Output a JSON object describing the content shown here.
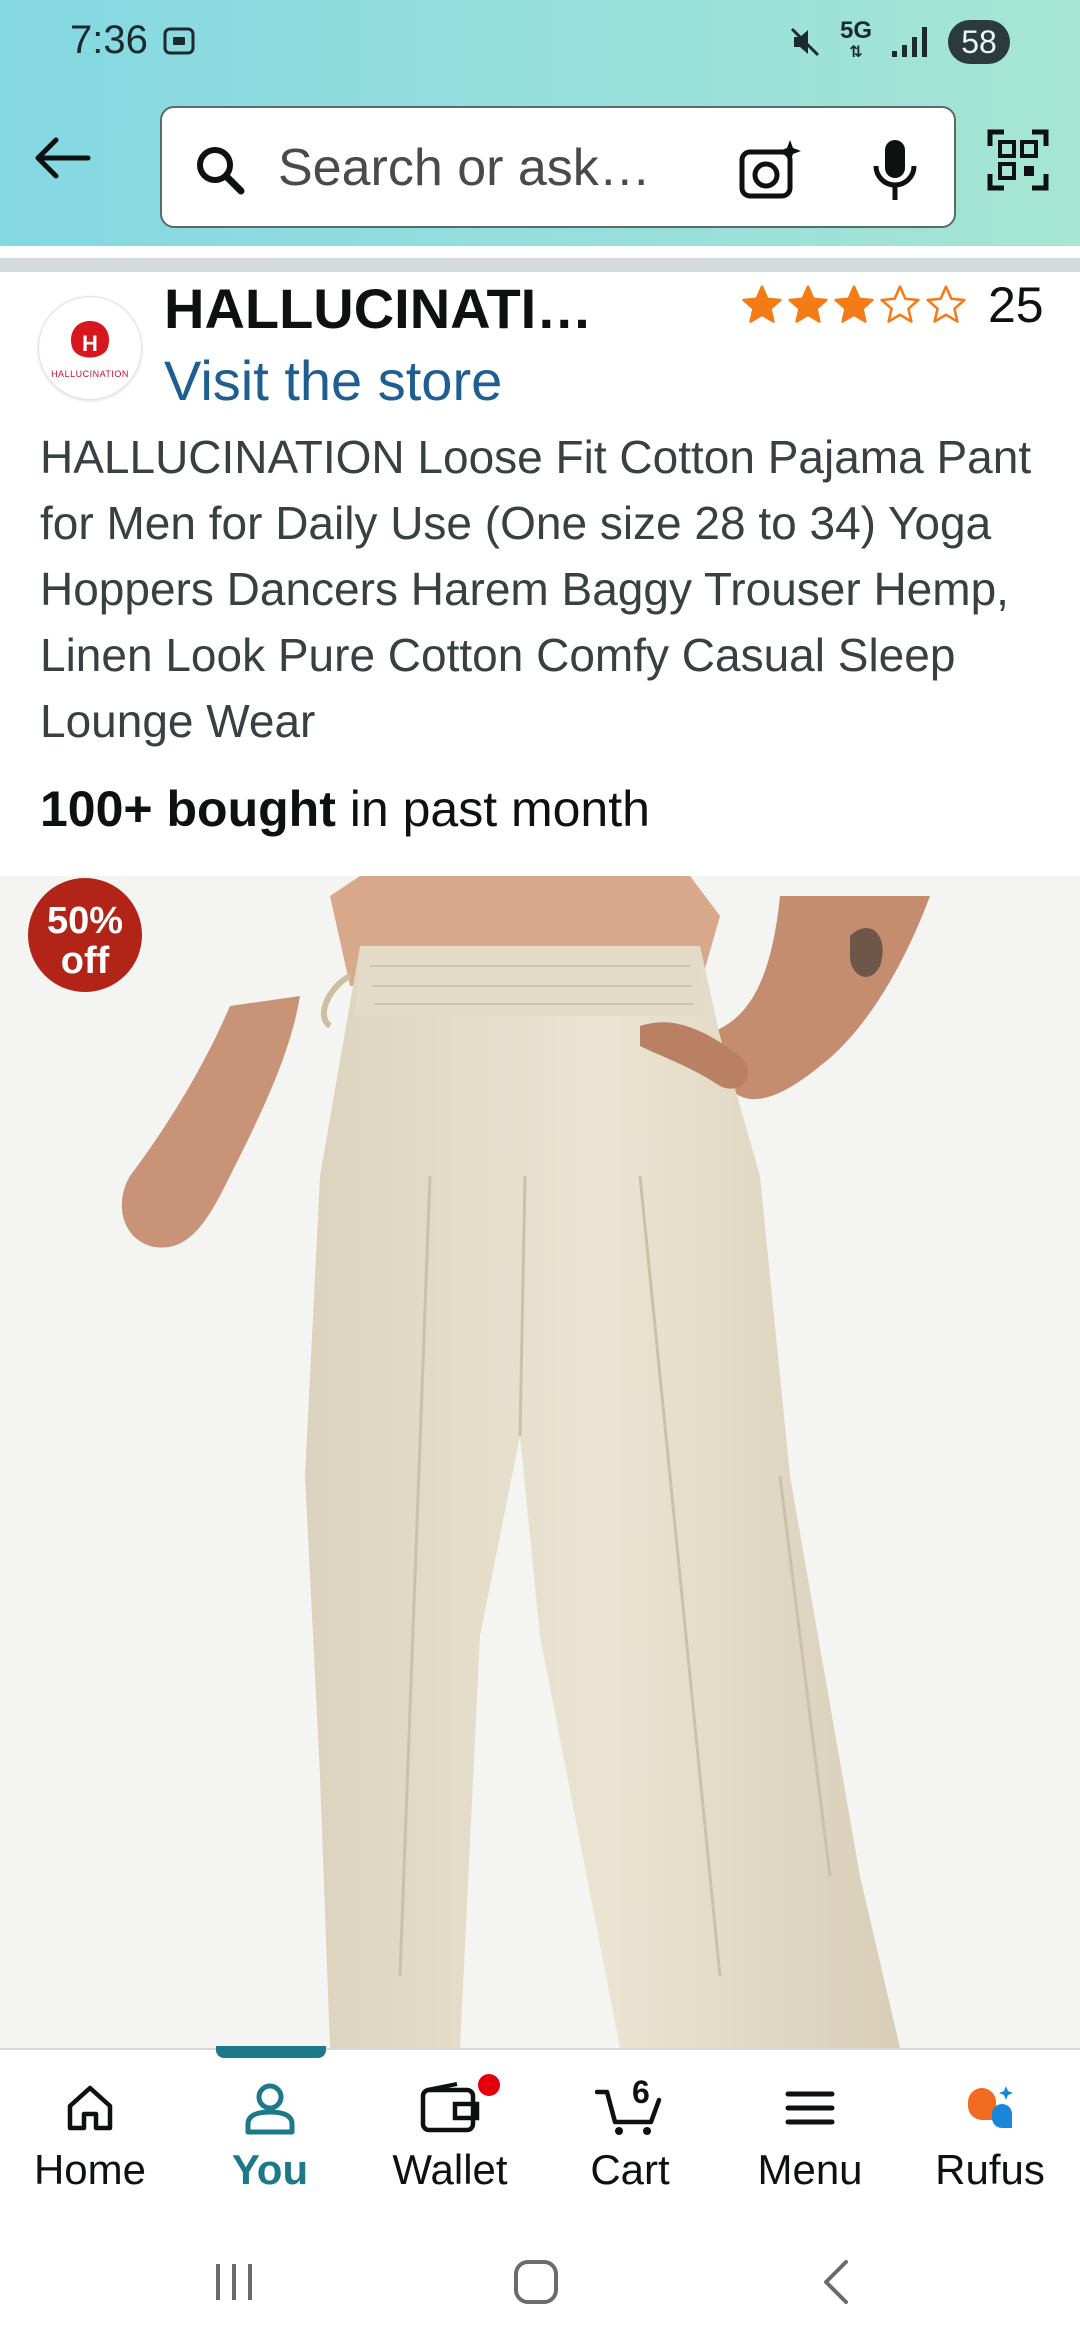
{
  "status_bar": {
    "time": "7:36",
    "network": "5G",
    "battery": "58"
  },
  "search": {
    "placeholder": "Search or ask…"
  },
  "brand": {
    "name": "HALLUCINATI…",
    "store_link": "Visit the store",
    "logo_text": "HALLUCINATION"
  },
  "rating": {
    "stars": 3,
    "max_stars": 5,
    "count": "25",
    "star_color": "#f47b16"
  },
  "product": {
    "title": "HALLUCINATION Loose Fit Cotton Pajama Pant for Men for Daily Use (One size 28 to 34) Yoga Hoppers Dancers Harem Baggy Trouser Hemp, Linen Look Pure Cotton Comfy Casual Sleep Lounge Wear",
    "bought_bold": "100+ bought",
    "bought_rest": " in past month",
    "discount_line1": "50%",
    "discount_line2": "off",
    "badge_color": "#b12417"
  },
  "bottom_nav": {
    "items": [
      {
        "label": "Home",
        "icon": "home-icon"
      },
      {
        "label": "You",
        "icon": "person-icon",
        "active": true
      },
      {
        "label": "Wallet",
        "icon": "wallet-icon",
        "notification_dot": true
      },
      {
        "label": "Cart",
        "icon": "cart-icon",
        "count": "6"
      },
      {
        "label": "Menu",
        "icon": "menu-icon"
      },
      {
        "label": "Rufus",
        "icon": "rufus-icon"
      }
    ],
    "active_color": "#1d7989"
  }
}
